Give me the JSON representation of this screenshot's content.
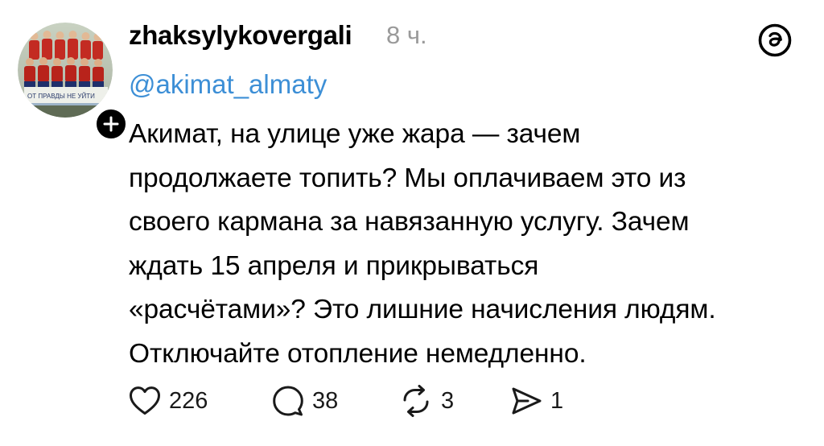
{
  "post": {
    "username": "zhaksylykovergali",
    "timestamp": "8 ч.",
    "mention": "@akimat_almaty",
    "text_lines": [
      "Акимат, на улице уже жара — зачем",
      "продолжаете топить? Мы оплачиваем это из",
      "своего кармана за навязанную услугу. Зачем",
      "ждать 15 апреля и прикрываться",
      "«расчётами»? Это лишние начисления людям.",
      "Отключайте отопление немедленно."
    ],
    "avatar_banner_text": "ОТ ПРАВДЫ НЕ УЙТИ"
  },
  "actions": {
    "likes": "226",
    "replies": "38",
    "reposts": "3",
    "shares": "1"
  },
  "colors": {
    "mention": "#3d8fd6",
    "timestamp": "#9a9a9a",
    "icon": "#1a1a1a"
  },
  "icons": {
    "like": "heart-icon",
    "reply": "speech-bubble-icon",
    "repost": "repost-arrows-icon",
    "share": "send-arrow-icon",
    "brand": "threads-logo-icon",
    "follow": "plus-icon"
  }
}
